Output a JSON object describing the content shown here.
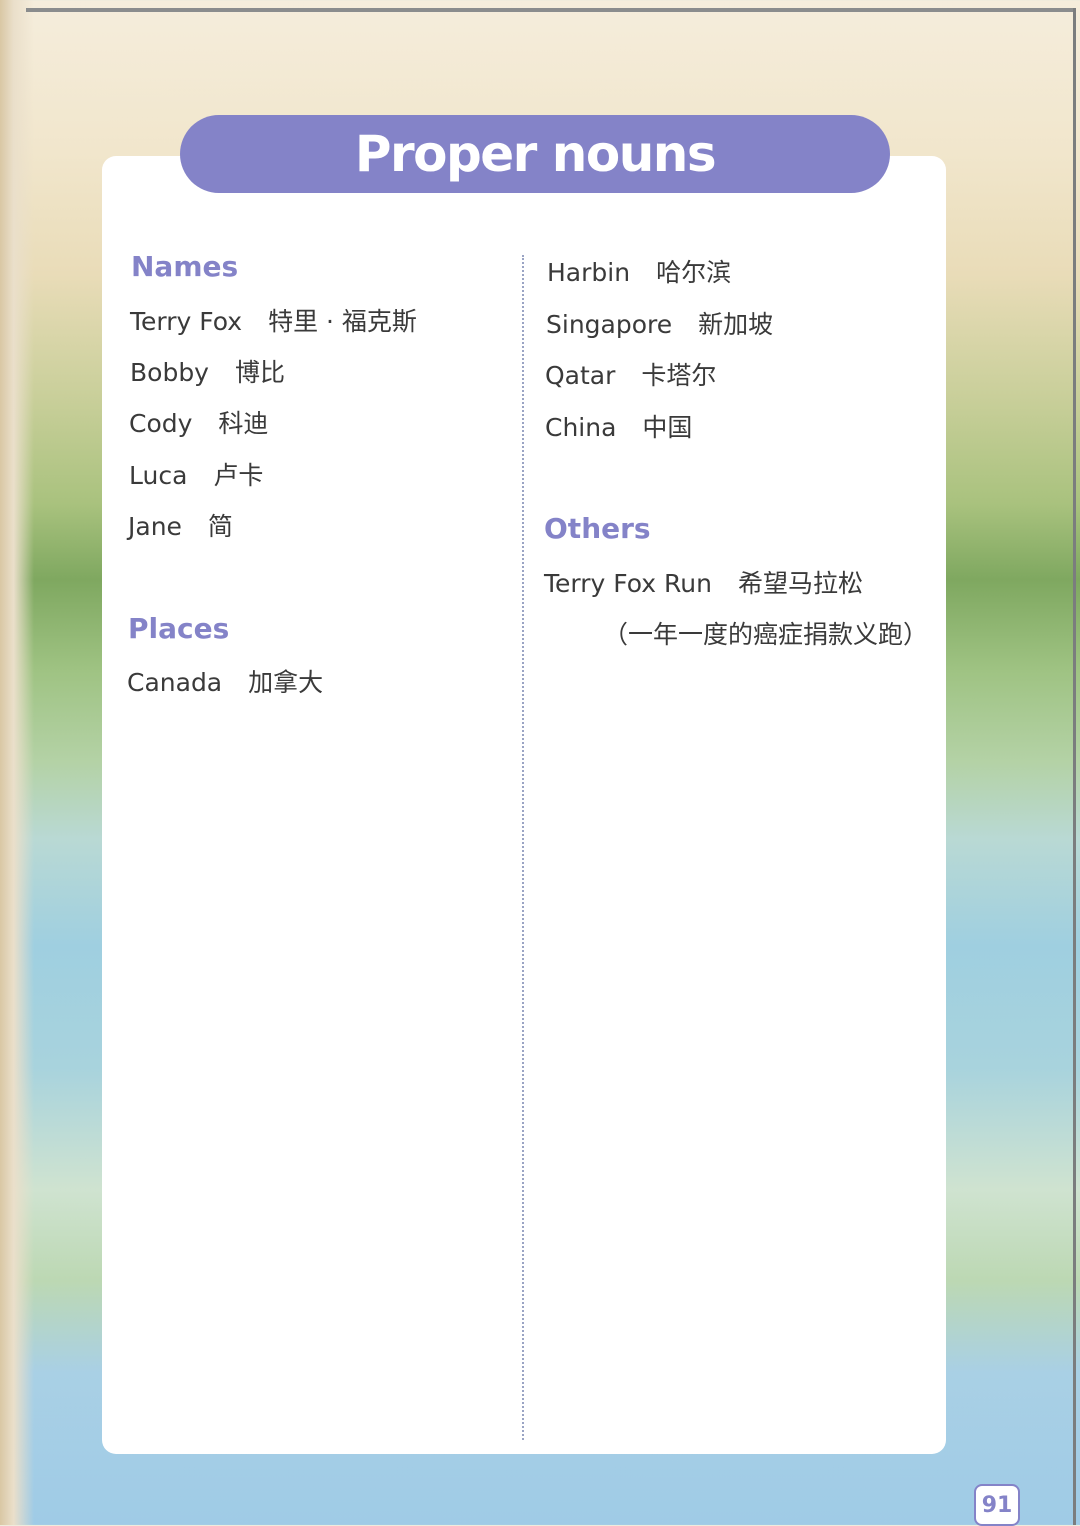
{
  "title": "Proper nouns",
  "names": {
    "heading": "Names",
    "items": [
      {
        "en": "Terry Fox",
        "zh": "特里 · 福克斯"
      },
      {
        "en": "Bobby",
        "zh": "博比"
      },
      {
        "en": "Cody",
        "zh": "科迪"
      },
      {
        "en": "Luca",
        "zh": "卢卡"
      },
      {
        "en": "Jane",
        "zh": "简"
      }
    ]
  },
  "places": {
    "heading": "Places",
    "items": [
      {
        "en": "Canada",
        "zh": "加拿大"
      },
      {
        "en": "Harbin",
        "zh": "哈尔滨"
      },
      {
        "en": "Singapore",
        "zh": "新加坡"
      },
      {
        "en": "Qatar",
        "zh": "卡塔尔"
      },
      {
        "en": "China",
        "zh": "中国"
      }
    ]
  },
  "others": {
    "heading": "Others",
    "items": [
      {
        "en": "Terry Fox Run",
        "zh": "希望马拉松",
        "note": "（一年一度的癌症捐款义跑）"
      }
    ]
  },
  "page_number": "91"
}
